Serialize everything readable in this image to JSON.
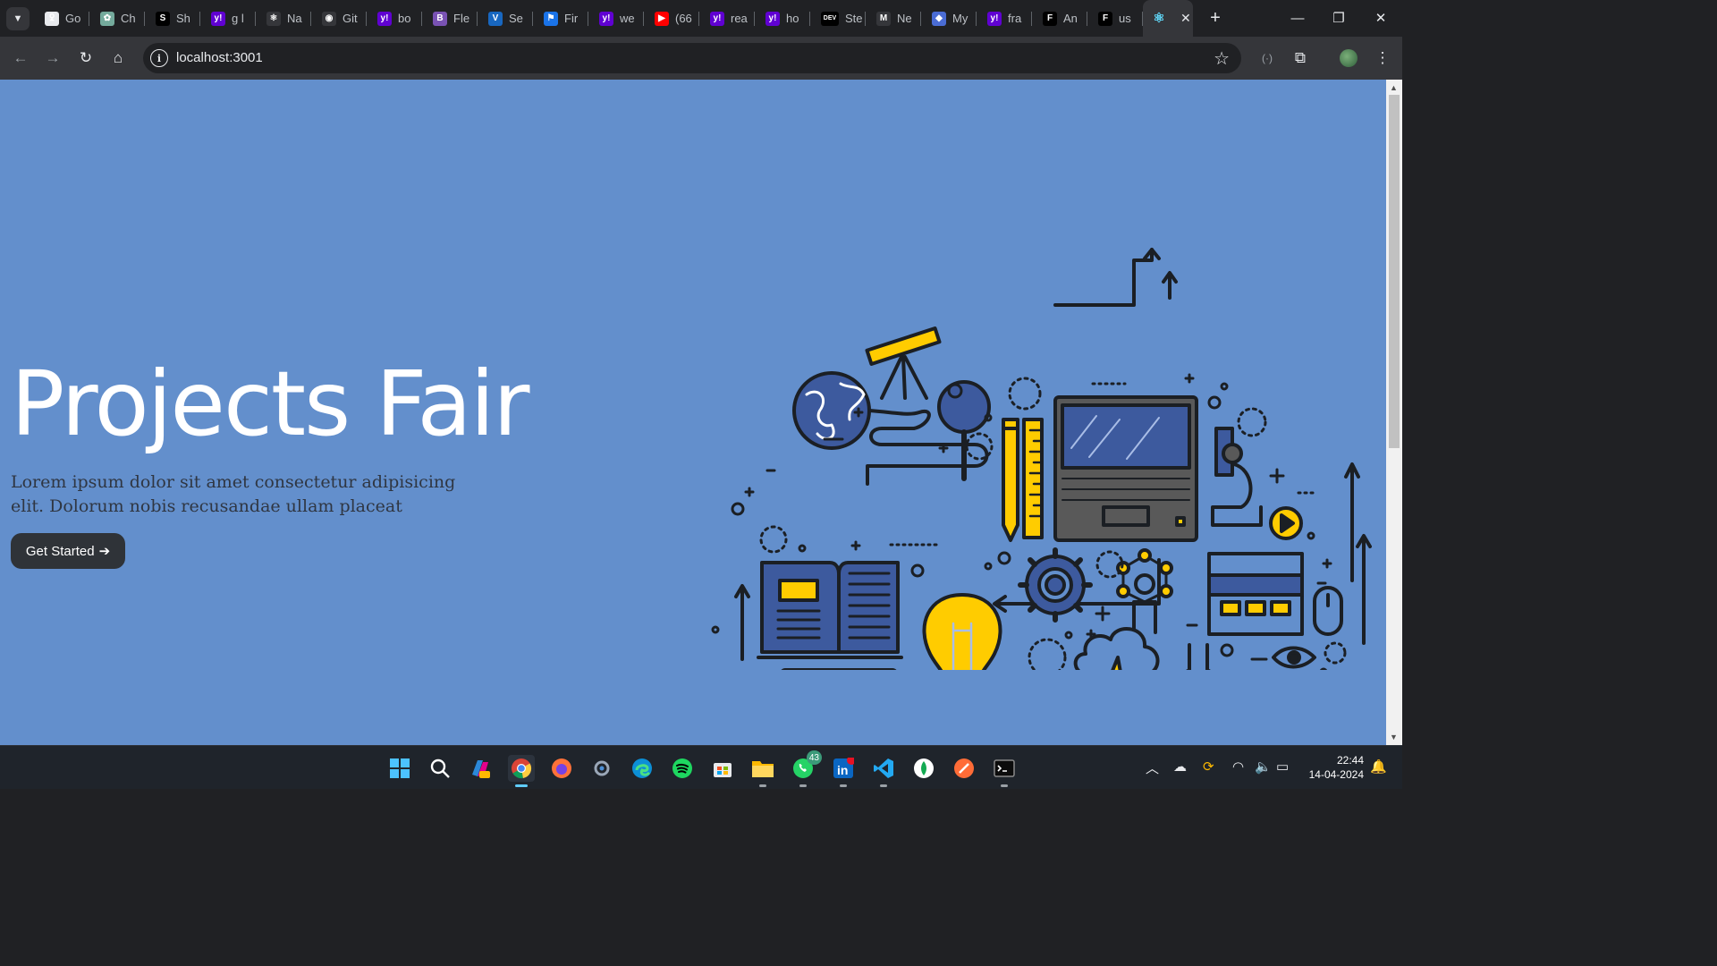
{
  "browser": {
    "tabs": [
      {
        "title": "Go",
        "icon": "chatgpt-alt-icon",
        "color": "#e8eaed",
        "glyph": "ꝿ"
      },
      {
        "title": "Ch",
        "icon": "openai-icon",
        "color": "#74aa9c",
        "glyph": "✿"
      },
      {
        "title": "Sh",
        "icon": "s-logo-icon",
        "color": "#000000",
        "glyph": "S"
      },
      {
        "title": "g l",
        "icon": "yahoo-icon",
        "color": "#6001d2",
        "glyph": "y!"
      },
      {
        "title": "Na",
        "icon": "react-icon",
        "color": "#35363a",
        "glyph": "⚛"
      },
      {
        "title": "Git",
        "icon": "github-icon",
        "color": "#35363a",
        "glyph": "◉"
      },
      {
        "title": "bo",
        "icon": "yahoo-icon",
        "color": "#6001d2",
        "glyph": "y!"
      },
      {
        "title": "Fle",
        "icon": "bootstrap-icon",
        "color": "#7952b3",
        "glyph": "B"
      },
      {
        "title": "Se",
        "icon": "vuetify-icon",
        "color": "#1867c0",
        "glyph": "V"
      },
      {
        "title": "Fir",
        "icon": "flag-icon",
        "color": "#1a73e8",
        "glyph": "⚑"
      },
      {
        "title": "we",
        "icon": "yahoo-icon",
        "color": "#6001d2",
        "glyph": "y!"
      },
      {
        "title": "(66",
        "icon": "youtube-icon",
        "color": "#ff0000",
        "glyph": "▶"
      },
      {
        "title": "rea",
        "icon": "yahoo-icon",
        "color": "#6001d2",
        "glyph": "y!"
      },
      {
        "title": "ho",
        "icon": "yahoo-icon",
        "color": "#6001d2",
        "glyph": "y!"
      },
      {
        "title": "Ste",
        "icon": "dev-icon",
        "color": "#000000",
        "glyph": "DEV"
      },
      {
        "title": "Ne",
        "icon": "gmail-icon",
        "color": "#35363a",
        "glyph": "M"
      },
      {
        "title": "My",
        "icon": "shield-icon",
        "color": "#4a6cd4",
        "glyph": "◆"
      },
      {
        "title": "fra",
        "icon": "yahoo-icon",
        "color": "#6001d2",
        "glyph": "y!"
      },
      {
        "title": "An",
        "icon": "framer-icon",
        "color": "#000000",
        "glyph": "F"
      },
      {
        "title": "us",
        "icon": "framer-icon",
        "color": "#000000",
        "glyph": "F"
      }
    ],
    "active_tab": {
      "icon": "react-icon",
      "glyph": "⚛",
      "close": "✕"
    },
    "url": "localhost:3001"
  },
  "hero": {
    "title": "Projects Fair",
    "text": "Lorem ipsum dolor sit amet consectetur adipisicing elit. Dolorum nobis recusandae ullam placeat",
    "button_label": "Get Started",
    "button_arrow": "➔"
  },
  "colors": {
    "page_bg": "#638fcc",
    "button_bg": "#2f3338",
    "illustration_yellow": "#ffcc00",
    "illustration_blue": "#3d5a9e"
  },
  "taskbar": {
    "apps": [
      "windows-start-icon",
      "search-icon",
      "copilot-icon",
      "chrome-icon",
      "firefox-icon",
      "settings-icon",
      "edge-icon",
      "spotify-icon",
      "microsoft-store-icon",
      "file-explorer-icon",
      "whatsapp-icon",
      "linkedin-icon",
      "vscode-icon",
      "mongodb-icon",
      "postman-icon",
      "terminal-icon"
    ],
    "whatsapp_badge": "43",
    "time": "22:44",
    "date": "14-04-2024"
  }
}
